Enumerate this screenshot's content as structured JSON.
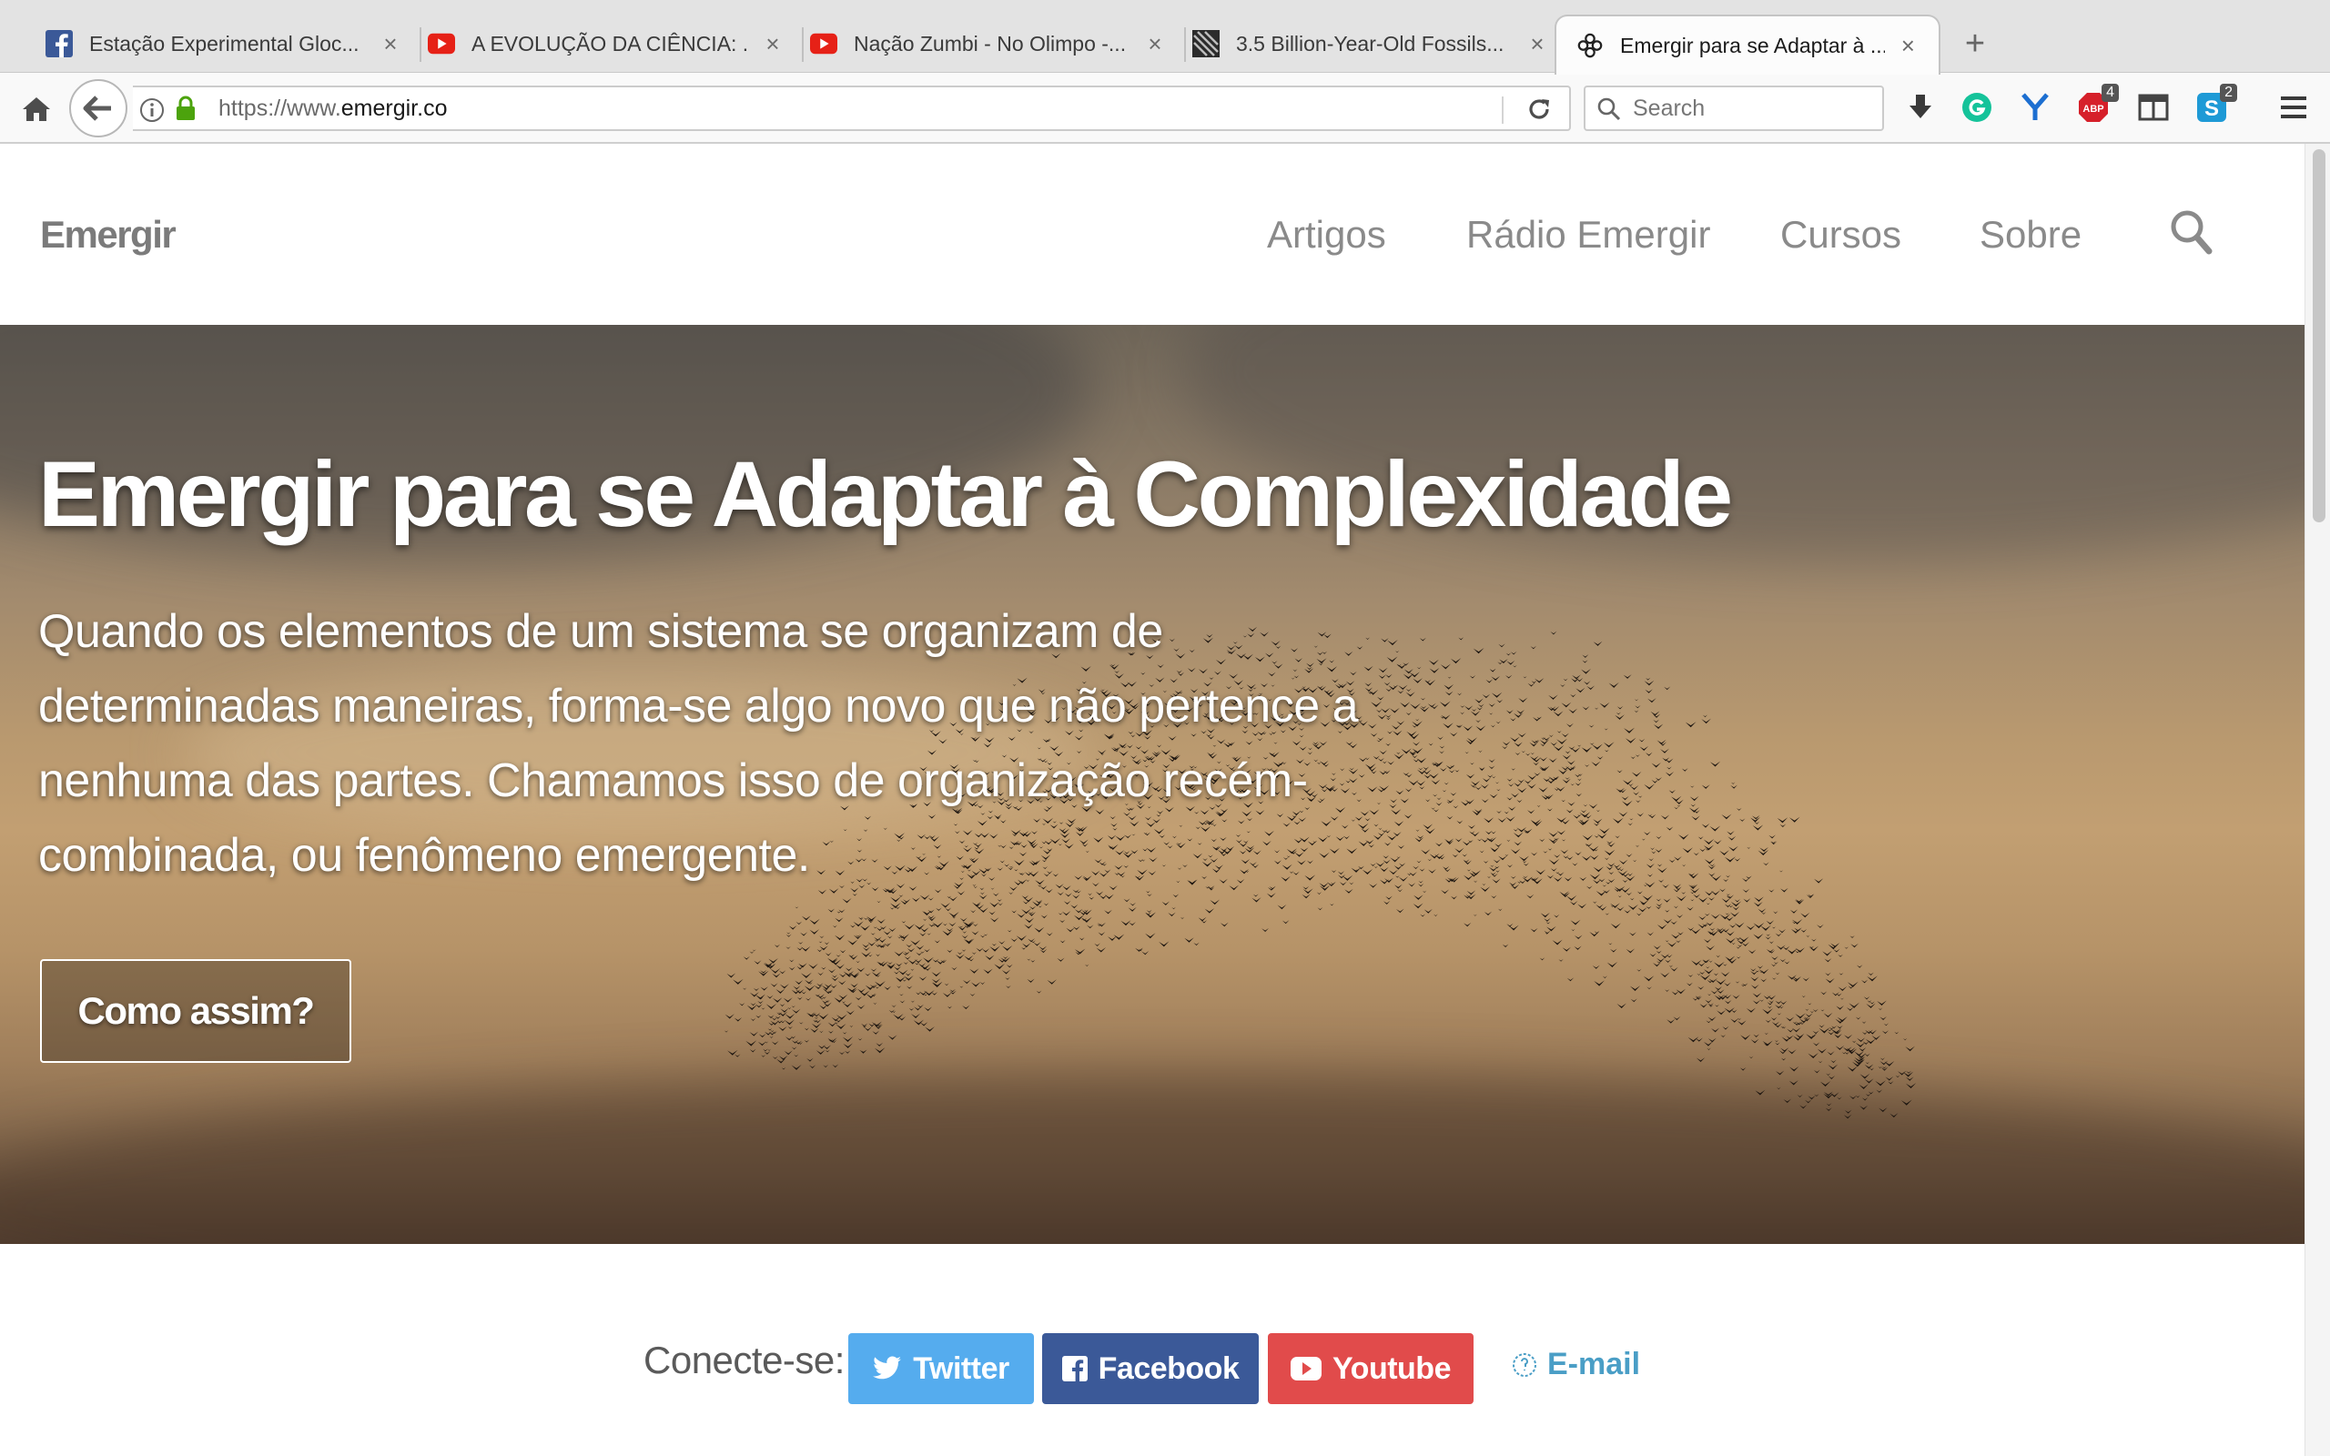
{
  "browser": {
    "tabs": [
      {
        "title": "Estação Experimental Gloc...",
        "icon": "facebook-favicon-icon",
        "active": false
      },
      {
        "title": "A EVOLUÇÃO DA CIÊNCIA: ...",
        "icon": "youtube-favicon-icon",
        "active": false
      },
      {
        "title": "Nação Zumbi - No Olimpo -...",
        "icon": "youtube-favicon-icon",
        "active": false
      },
      {
        "title": "3.5 Billion-Year-Old Fossils...",
        "icon": "fossil-favicon-icon",
        "active": false
      },
      {
        "title": "Emergir para se Adaptar à ...",
        "icon": "emergir-favicon-icon",
        "active": true
      }
    ],
    "close_glyph": "×",
    "newtab_glyph": "+",
    "url_prefix": "https://www.",
    "url_domain": "emergir.co",
    "search_placeholder": "Search",
    "badges": {
      "abp": "4",
      "skype": "2"
    }
  },
  "site": {
    "brand": "Emergir",
    "menu": [
      "Artigos",
      "Rádio Emergir",
      "Cursos",
      "Sobre"
    ]
  },
  "hero": {
    "title": "Emergir para se Adaptar à Complexidade",
    "lines": [
      "Quando os elementos de um sistema se organizam de",
      "determinadas maneiras, forma-se algo novo que não pertence a",
      "nenhuma das partes. Chamamos isso de organização recém-",
      "combinada, ou fenômeno emergente."
    ],
    "button": "Como assim?"
  },
  "connect": {
    "label": "Conecte-se:",
    "buttons": [
      {
        "label": "Twitter",
        "color": "#55acee"
      },
      {
        "label": "Facebook",
        "color": "#3b5998"
      },
      {
        "label": "Youtube",
        "color": "#e14b4b"
      }
    ],
    "email": "E-mail",
    "email_color": "#4a9ec6"
  }
}
